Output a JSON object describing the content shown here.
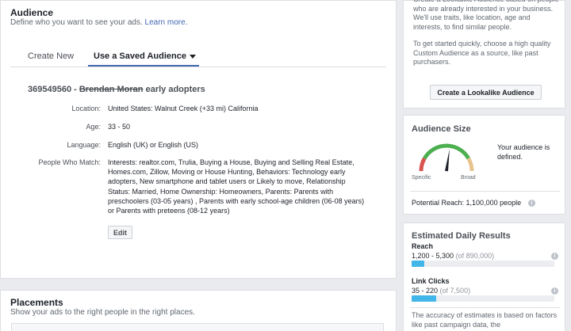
{
  "audience": {
    "title": "Audience",
    "subtitle": "Define who you want to see your ads.",
    "learn_more": "Learn more.",
    "tabs": [
      {
        "label": "Create New",
        "active": false
      },
      {
        "label": "Use a Saved Audience",
        "active": true
      }
    ],
    "saved_name_prefix": "369549560 - ",
    "saved_name_struck": "Brendan Moran",
    "saved_name_suffix": " early adopters",
    "rows": [
      {
        "label": "Location:",
        "value": "United States: Walnut Creek (+33 mi) California"
      },
      {
        "label": "Age:",
        "value": "33 - 50"
      },
      {
        "label": "Language:",
        "value": "English (UK) or English (US)"
      },
      {
        "label": "People Who Match:",
        "value": "Interests: realtor.com, Trulia, Buying a House, Buying and Selling Real Estate, Homes.com, Zillow, Moving or House Hunting, Behaviors: Technology early adopters, New smartphone and tablet users or Likely to move, Relationship Status: Married, Home Ownership: Homeowners, Parents: Parents with preschoolers (03-05 years) , Parents with early school-age children (06-08 years) or Parents with preteens (08-12 years)"
      }
    ],
    "edit_label": "Edit"
  },
  "placements": {
    "title": "Placements",
    "subtitle": "Show your ads to the right people in the right places."
  },
  "lookalike": {
    "text1": "Create a Lookalike Audience based on people who are already interested in your business. We'll use traits, like location, age and interests, to find similar people.",
    "text2": "To get started quickly, choose a high quality Custom Audience as a source, like past purchasers.",
    "button_label": "Create a Lookalike Audience"
  },
  "audience_size": {
    "title": "Audience Size",
    "gauge_left_label": "Specific",
    "gauge_right_label": "Broad",
    "gauge_level": 0.55,
    "description": "Your audience is defined.",
    "potential_reach": "Potential Reach: 1,100,000 people"
  },
  "daily_results": {
    "title": "Estimated Daily Results",
    "metrics": [
      {
        "label": "Reach",
        "value": "1,200 - 5,300",
        "of": "(of 890,000)",
        "fill": 0.09
      },
      {
        "label": "Link Clicks",
        "value": "35 - 220",
        "of": "(of 7,500)",
        "fill": 0.17
      }
    ],
    "note": "The accuracy of estimates is based on factors like past campaign data, the"
  },
  "colors": {
    "accent": "#4267b2",
    "bar_fill": "#42b6e8",
    "gauge_red": "#d9534f",
    "gauge_green": "#4caf50",
    "gauge_tan": "#e8c48f"
  },
  "icons": {
    "info": "info-icon",
    "dropdown": "caret-down-icon"
  }
}
